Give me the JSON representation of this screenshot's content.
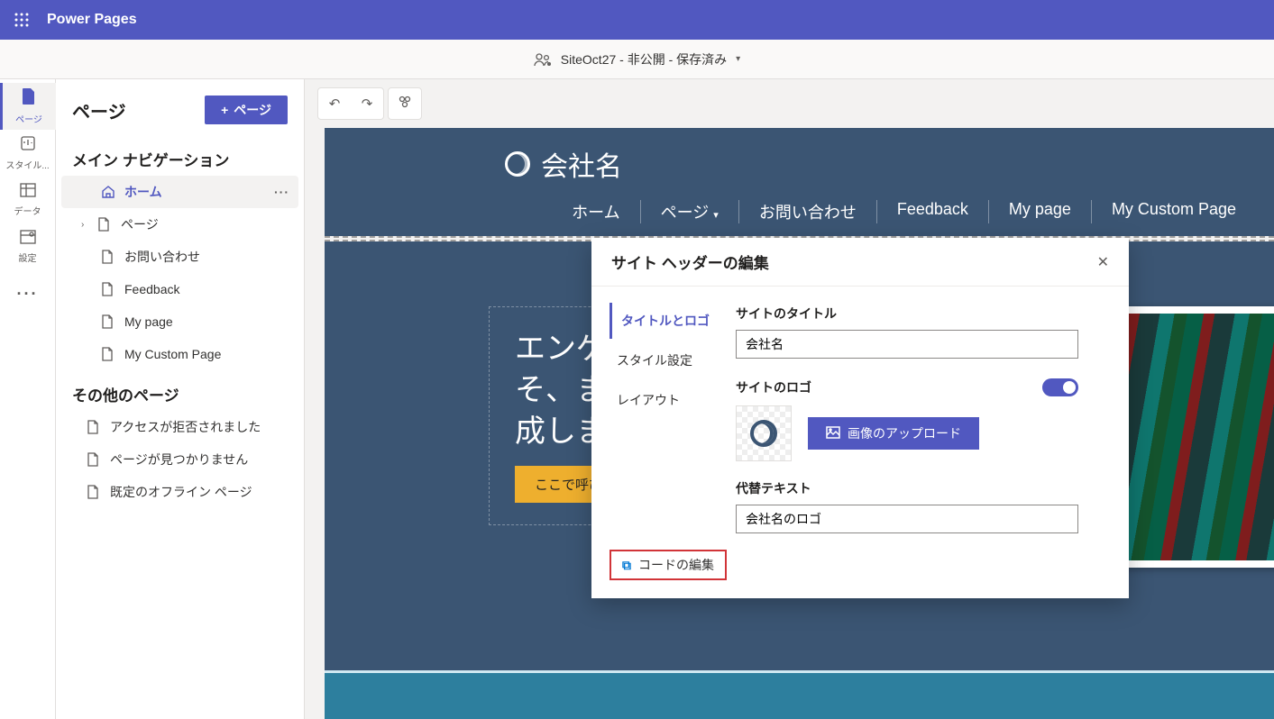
{
  "app": {
    "brand": "Power Pages"
  },
  "subheader": {
    "siteStatus": "SiteOct27 - 非公開 - 保存済み"
  },
  "rail": {
    "items": [
      {
        "label": "ページ",
        "icon": "page"
      },
      {
        "label": "スタイル...",
        "icon": "style"
      },
      {
        "label": "データ",
        "icon": "data"
      },
      {
        "label": "設定",
        "icon": "settings"
      },
      {
        "label": "",
        "icon": "more"
      }
    ]
  },
  "nav": {
    "title": "ページ",
    "addBtn": "ページ",
    "mainSection": "メイン ナビゲーション",
    "mainItems": [
      {
        "label": "ホーム",
        "level": 0,
        "icon": "home",
        "selected": true,
        "more": true
      },
      {
        "label": "ページ",
        "level": 0,
        "icon": "page",
        "expandable": true
      },
      {
        "label": "お問い合わせ",
        "level": 1,
        "icon": "page"
      },
      {
        "label": "Feedback",
        "level": 1,
        "icon": "page"
      },
      {
        "label": "My page",
        "level": 1,
        "icon": "page"
      },
      {
        "label": "My Custom Page",
        "level": 1,
        "icon": "page"
      }
    ],
    "otherSection": "その他のページ",
    "otherItems": [
      {
        "label": "アクセスが拒否されました"
      },
      {
        "label": "ページが見つかりません"
      },
      {
        "label": "既定のオフライン ページ"
      }
    ]
  },
  "site": {
    "companyName": "会社名",
    "navLinks": [
      "ホーム",
      "ページ",
      "お問い合わせ",
      "Feedback",
      "My page",
      "My Custom Page"
    ],
    "heroLine1": "エンゲー",
    "heroLine2": "そ、また",
    "heroLine3": "成しま",
    "cta": "ここで呼び出"
  },
  "modal": {
    "title": "サイト ヘッダーの編集",
    "tabs": [
      "タイトルとロゴ",
      "スタイル設定",
      "レイアウト"
    ],
    "codeEdit": "コードの編集",
    "form": {
      "siteTitleLabel": "サイトのタイトル",
      "siteTitleValue": "会社名",
      "siteLogoLabel": "サイトのロゴ",
      "uploadBtn": "画像のアップロード",
      "altTextLabel": "代替テキスト",
      "altTextValue": "会社名のロゴ"
    }
  }
}
